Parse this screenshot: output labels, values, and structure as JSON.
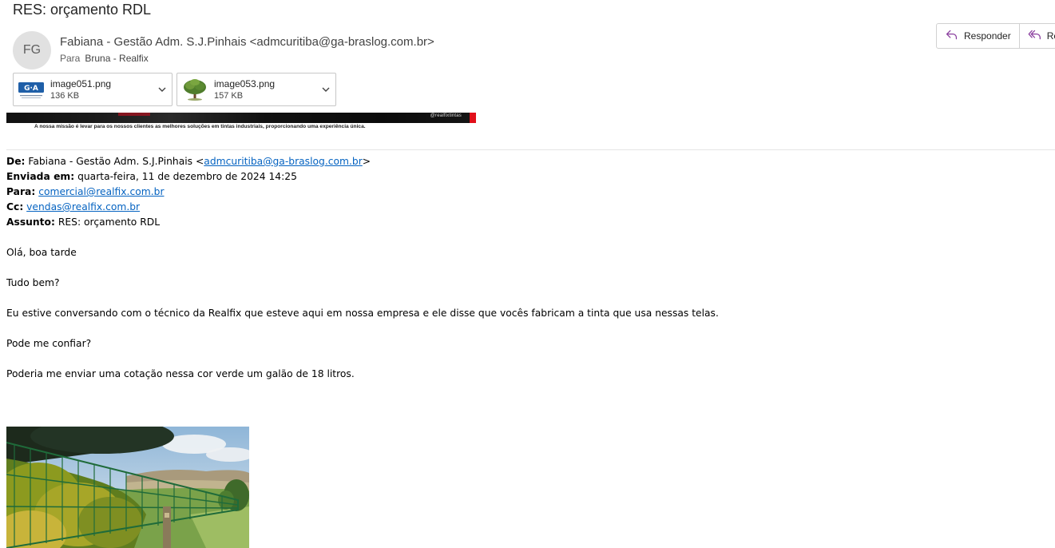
{
  "subject": "RES: orçamento RDL",
  "sender": {
    "initials": "FG",
    "display": "Fabiana - Gestão Adm. S.J.Pinhais <admcuritiba@ga-braslog.com.br>",
    "to_label": "Para",
    "to_name": "Bruna - Realfix"
  },
  "actions": {
    "reply": "Responder",
    "reply_all": "Re"
  },
  "attachments": [
    {
      "name": "image051.png",
      "size": "136 KB",
      "thumb_icon": "ga-logo-icon"
    },
    {
      "name": "image053.png",
      "size": "157 KB",
      "thumb_icon": "tree-icon"
    }
  ],
  "banner": {
    "handle": "@realfixtintas",
    "tagline": "A nossa missão é levar para os nossos clientes as melhores soluções em tintas industriais, proporcionando uma experiência única."
  },
  "header_block": {
    "from_label": "De:",
    "from_name": "Fabiana - Gestão Adm. S.J.Pinhais <",
    "from_email": "admcuritiba@ga-braslog.com.br",
    "from_close": ">",
    "sent_label": "Enviada em:",
    "sent_value": "quarta-feira, 11 de dezembro de 2024 14:25",
    "to_label": "Para:",
    "to_email": "comercial@realfix.com.br",
    "cc_label": "Cc:",
    "cc_email": "vendas@realfix.com.br",
    "subject_label": "Assunto:",
    "subject_value": "RES: orçamento RDL"
  },
  "body": {
    "greeting": "Olá, boa tarde",
    "line1": "Tudo bem?",
    "line2": "Eu estive conversando com o técnico da Realfix que esteve aqui em nossa empresa e ele disse que vocês fabricam a tinta que usa nessas telas.",
    "line3": "Pode me confiar?",
    "line4": "Poderia me enviar uma cotação nessa cor verde um galão de 18 litros."
  },
  "colors": {
    "link": "#0563c1",
    "avatar_bg": "#e1e1e1",
    "reply_icon": "#8a3e9e",
    "banner_red": "#e10f1a"
  }
}
